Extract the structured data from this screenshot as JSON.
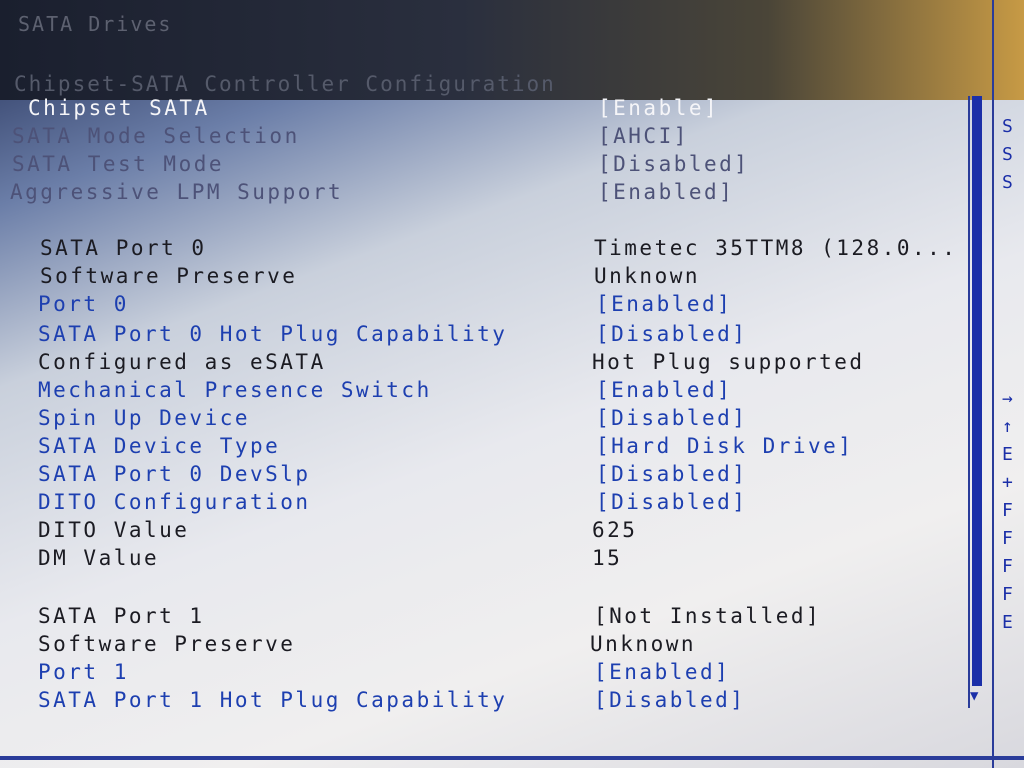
{
  "header": {
    "title": "SATA Drives"
  },
  "section": {
    "title": "Chipset-SATA Controller Configuration"
  },
  "settings": [
    {
      "label": "Chipset SATA",
      "value": "[Enable]"
    },
    {
      "label": "SATA Mode Selection",
      "value": "[AHCI]"
    },
    {
      "label": "SATA Test Mode",
      "value": "[Disabled]"
    },
    {
      "label": "Aggressive LPM Support",
      "value": "[Enabled]"
    },
    {
      "label": "SATA Port 0",
      "value": "Timetec 35TTM8 (128.0..."
    },
    {
      "label": "Software Preserve",
      "value": "Unknown"
    },
    {
      "label": "Port 0",
      "value": "[Enabled]"
    },
    {
      "label": "SATA Port 0 Hot Plug Capability",
      "value": "[Disabled]"
    },
    {
      "label": "Configured as eSATA",
      "value": "Hot Plug supported"
    },
    {
      "label": "Mechanical Presence Switch",
      "value": "[Enabled]"
    },
    {
      "label": "Spin Up Device",
      "value": "[Disabled]"
    },
    {
      "label": "SATA Device Type",
      "value": "[Hard Disk Drive]"
    },
    {
      "label": "SATA Port 0 DevSlp",
      "value": "[Disabled]"
    },
    {
      "label": "DITO Configuration",
      "value": "[Disabled]"
    },
    {
      "label": "DITO Value",
      "value": "625"
    },
    {
      "label": "DM Value",
      "value": "15"
    },
    {
      "label": "SATA Port 1",
      "value": "[Not Installed]"
    },
    {
      "label": "Software Preserve",
      "value": "Unknown"
    },
    {
      "label": "Port 1",
      "value": "[Enabled]"
    },
    {
      "label": "SATA Port 1 Hot Plug Capability",
      "value": "[Disabled]"
    }
  ],
  "help_keys": [
    "S",
    "S",
    "S",
    "→",
    "↑",
    "E",
    "+",
    "F",
    "F",
    "F",
    "F",
    "E"
  ],
  "colors": {
    "selected": "#f5f5f8",
    "inactive": "#4d5278",
    "static": "#1b1b22",
    "configurable": "#1d3fb0",
    "border": "#2a3c9a"
  }
}
